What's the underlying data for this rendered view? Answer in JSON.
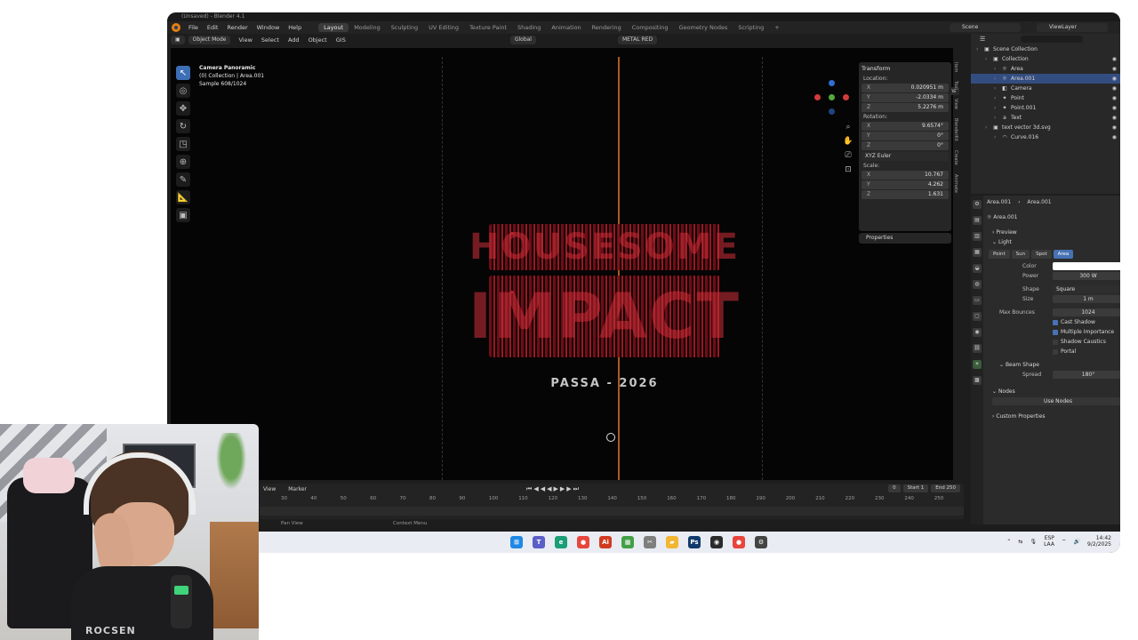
{
  "window": {
    "title": "(Unsaved) - Blender 4.1"
  },
  "menu": [
    "File",
    "Edit",
    "Render",
    "Window",
    "Help"
  ],
  "workspaces": [
    "Layout",
    "Modeling",
    "Sculpting",
    "UV Editing",
    "Texture Paint",
    "Shading",
    "Animation",
    "Rendering",
    "Compositing",
    "Geometry Nodes",
    "Scripting",
    "+"
  ],
  "active_workspace": "Layout",
  "scene": "Scene",
  "view_layer": "ViewLayer",
  "viewport_header": {
    "mode": "Object Mode",
    "menus": [
      "View",
      "Select",
      "Add",
      "Object",
      "GIS"
    ],
    "orientation": "Global",
    "material": "METAL RED",
    "options": "Options"
  },
  "viewport_info": {
    "camera": "Camera Panoramic",
    "collection": "(0) Collection | Area.001",
    "sample": "Sample 608/1024"
  },
  "artwork": {
    "line1": "HOUSESOME",
    "line2": "IMPACT",
    "subtitle": "PASSA - 2026"
  },
  "transform": {
    "header": "Transform",
    "location_label": "Location:",
    "location": {
      "x": "0.020951 m",
      "y": "-2.0334 m",
      "z": "5.2276 m"
    },
    "rotation_label": "Rotation:",
    "rotation": {
      "x": "9.6574°",
      "y": "0°",
      "z": "0°"
    },
    "rotation_mode": "XYZ Euler",
    "scale_label": "Scale:",
    "scale": {
      "x": "10.767",
      "y": "4.262",
      "z": "1.631"
    },
    "properties": "Properties"
  },
  "side_tabs": [
    "Item",
    "Tool",
    "View",
    "BlenderKit",
    "Create",
    "Animate"
  ],
  "outliner": {
    "search_placeholder": "",
    "rows": [
      {
        "label": "Scene Collection",
        "indent": 0,
        "selected": false
      },
      {
        "label": "Collection",
        "indent": 1,
        "selected": false
      },
      {
        "label": "Area",
        "indent": 2,
        "selected": false
      },
      {
        "label": "Area.001",
        "indent": 2,
        "selected": true
      },
      {
        "label": "Camera",
        "indent": 2,
        "selected": false
      },
      {
        "label": "Point",
        "indent": 2,
        "selected": false
      },
      {
        "label": "Point.001",
        "indent": 2,
        "selected": false
      },
      {
        "label": "Text",
        "indent": 2,
        "selected": false
      },
      {
        "label": "text vector 3d.svg",
        "indent": 1,
        "selected": false
      },
      {
        "label": "Curve.016",
        "indent": 2,
        "selected": false
      }
    ]
  },
  "properties": {
    "breadcrumb_obj": "Area.001",
    "breadcrumb_data": "Area.001",
    "datablock": "Area.001",
    "preview": "Preview",
    "light": "Light",
    "light_types": [
      "Point",
      "Sun",
      "Spot",
      "Area"
    ],
    "active_type": "Area",
    "color_label": "Color",
    "power_label": "Power",
    "power_value": "300 W",
    "shape_label": "Shape",
    "shape_value": "Square",
    "size_label": "Size",
    "size_value": "1 m",
    "max_bounces_label": "Max Bounces",
    "max_bounces_value": "1024",
    "cast_shadow": "Cast Shadow",
    "multiple_importance": "Multiple Importance",
    "shadow_caustics": "Shadow Caustics",
    "portal": "Portal",
    "beam_shape": "Beam Shape",
    "spread_label": "Spread",
    "spread_value": "180°",
    "nodes": "Nodes",
    "use_nodes": "Use Nodes",
    "custom_properties": "Custom Properties"
  },
  "timeline": {
    "view": "View",
    "marker": "Marker",
    "current_frame": "0",
    "start_label": "Start",
    "start": "1",
    "end_label": "End",
    "end": "250",
    "ticks": [
      "30",
      "40",
      "50",
      "60",
      "70",
      "80",
      "90",
      "100",
      "110",
      "120",
      "130",
      "140",
      "150",
      "160",
      "170",
      "180",
      "190",
      "200",
      "210",
      "220",
      "230",
      "240",
      "250"
    ]
  },
  "status": {
    "left": "Pan View",
    "mid": "Context Menu"
  },
  "taskbar": {
    "lang": "ESP",
    "lang2": "LAA",
    "time": "14:42",
    "date": "9/2/2025"
  },
  "webcam": {
    "shirt_text": "ROCSEN"
  },
  "colors": {
    "accent": "#4772b3",
    "selection": "#334d80",
    "orange": "#e87d0d"
  }
}
